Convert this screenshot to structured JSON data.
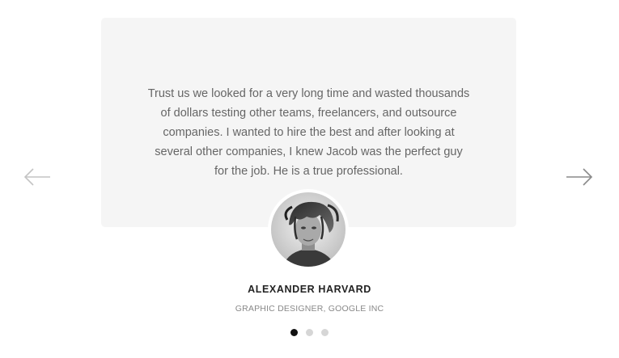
{
  "testimonial": {
    "quote": "Trust us we looked for a very long time and wasted thousands of dollars testing other teams, freelancers, and outsource companies. I wanted to hire the best and after looking at several other companies, I knew Jacob was the perfect guy for the job. He is a true professional.",
    "name": "ALEXANDER HARVARD",
    "role": "GRAPHIC DESIGNER, GOOGLE INC"
  },
  "navigation": {
    "prev_icon": "arrow-left-icon",
    "next_icon": "arrow-right-icon"
  },
  "pagination": {
    "count": 3,
    "active_index": 0
  },
  "colors": {
    "card_background": "#f5f5f5",
    "quote_text": "#666666",
    "name_text": "#222222",
    "role_text": "#888888",
    "dot_active": "#111111",
    "dot_inactive": "#d6d6d6"
  }
}
